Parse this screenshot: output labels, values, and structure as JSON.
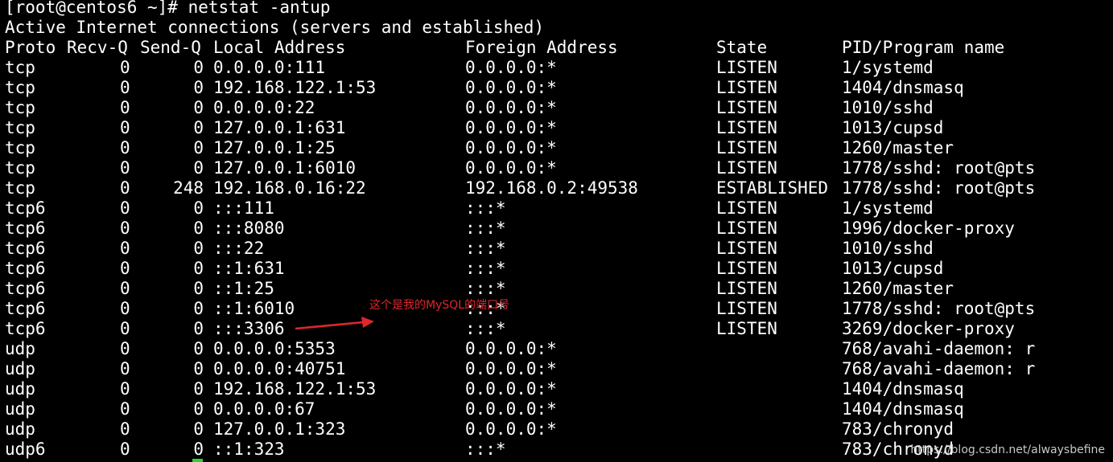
{
  "terminal": {
    "prompt_line": "[root@centos6 ~]# netstat -antup",
    "info_line": "Active Internet connections (servers and established)",
    "headers": {
      "proto": "Proto",
      "recvq": "Recv-Q",
      "sendq": "Send-Q",
      "local": "Local Address",
      "foreign": "Foreign Address",
      "state": "State",
      "pid": "PID/Program name"
    },
    "rows": [
      {
        "proto": "tcp",
        "recvq": "0",
        "sendq": "0",
        "local": "0.0.0.0:111",
        "foreign": "0.0.0.0:*",
        "state": "LISTEN",
        "pid": "1/systemd"
      },
      {
        "proto": "tcp",
        "recvq": "0",
        "sendq": "0",
        "local": "192.168.122.1:53",
        "foreign": "0.0.0.0:*",
        "state": "LISTEN",
        "pid": "1404/dnsmasq"
      },
      {
        "proto": "tcp",
        "recvq": "0",
        "sendq": "0",
        "local": "0.0.0.0:22",
        "foreign": "0.0.0.0:*",
        "state": "LISTEN",
        "pid": "1010/sshd"
      },
      {
        "proto": "tcp",
        "recvq": "0",
        "sendq": "0",
        "local": "127.0.0.1:631",
        "foreign": "0.0.0.0:*",
        "state": "LISTEN",
        "pid": "1013/cupsd"
      },
      {
        "proto": "tcp",
        "recvq": "0",
        "sendq": "0",
        "local": "127.0.0.1:25",
        "foreign": "0.0.0.0:*",
        "state": "LISTEN",
        "pid": "1260/master"
      },
      {
        "proto": "tcp",
        "recvq": "0",
        "sendq": "0",
        "local": "127.0.0.1:6010",
        "foreign": "0.0.0.0:*",
        "state": "LISTEN",
        "pid": "1778/sshd: root@pts"
      },
      {
        "proto": "tcp",
        "recvq": "0",
        "sendq": "248",
        "local": "192.168.0.16:22",
        "foreign": "192.168.0.2:49538",
        "state": "ESTABLISHED",
        "pid": "1778/sshd: root@pts"
      },
      {
        "proto": "tcp6",
        "recvq": "0",
        "sendq": "0",
        "local": ":::111",
        "foreign": ":::*",
        "state": "LISTEN",
        "pid": "1/systemd"
      },
      {
        "proto": "tcp6",
        "recvq": "0",
        "sendq": "0",
        "local": ":::8080",
        "foreign": ":::*",
        "state": "LISTEN",
        "pid": "1996/docker-proxy"
      },
      {
        "proto": "tcp6",
        "recvq": "0",
        "sendq": "0",
        "local": ":::22",
        "foreign": ":::*",
        "state": "LISTEN",
        "pid": "1010/sshd"
      },
      {
        "proto": "tcp6",
        "recvq": "0",
        "sendq": "0",
        "local": "::1:631",
        "foreign": ":::*",
        "state": "LISTEN",
        "pid": "1013/cupsd"
      },
      {
        "proto": "tcp6",
        "recvq": "0",
        "sendq": "0",
        "local": "::1:25",
        "foreign": ":::*",
        "state": "LISTEN",
        "pid": "1260/master"
      },
      {
        "proto": "tcp6",
        "recvq": "0",
        "sendq": "0",
        "local": "::1:6010",
        "foreign": ":::*",
        "state": "LISTEN",
        "pid": "1778/sshd: root@pts"
      },
      {
        "proto": "tcp6",
        "recvq": "0",
        "sendq": "0",
        "local": ":::3306",
        "foreign": ":::*",
        "state": "LISTEN",
        "pid": "3269/docker-proxy"
      },
      {
        "proto": "udp",
        "recvq": "0",
        "sendq": "0",
        "local": "0.0.0.0:5353",
        "foreign": "0.0.0.0:*",
        "state": "",
        "pid": "768/avahi-daemon: r"
      },
      {
        "proto": "udp",
        "recvq": "0",
        "sendq": "0",
        "local": "0.0.0.0:40751",
        "foreign": "0.0.0.0:*",
        "state": "",
        "pid": "768/avahi-daemon: r"
      },
      {
        "proto": "udp",
        "recvq": "0",
        "sendq": "0",
        "local": "192.168.122.1:53",
        "foreign": "0.0.0.0:*",
        "state": "",
        "pid": "1404/dnsmasq"
      },
      {
        "proto": "udp",
        "recvq": "0",
        "sendq": "0",
        "local": "0.0.0.0:67",
        "foreign": "0.0.0.0:*",
        "state": "",
        "pid": "1404/dnsmasq"
      },
      {
        "proto": "udp",
        "recvq": "0",
        "sendq": "0",
        "local": "127.0.0.1:323",
        "foreign": "0.0.0.0:*",
        "state": "",
        "pid": "783/chronyd"
      },
      {
        "proto": "udp6",
        "recvq": "0",
        "sendq": "0",
        "local": "::1:323",
        "foreign": ":::*",
        "state": "",
        "pid": "783/chronyd"
      }
    ]
  },
  "annotation": {
    "text": "这个是我的MySQL的端口号",
    "color": "#e0262b"
  },
  "watermark": "https://blog.csdn.net/alwaysbefine",
  "colors": {
    "background": "#000000",
    "text": "#ffffff",
    "cursor": "#2fd12f"
  }
}
